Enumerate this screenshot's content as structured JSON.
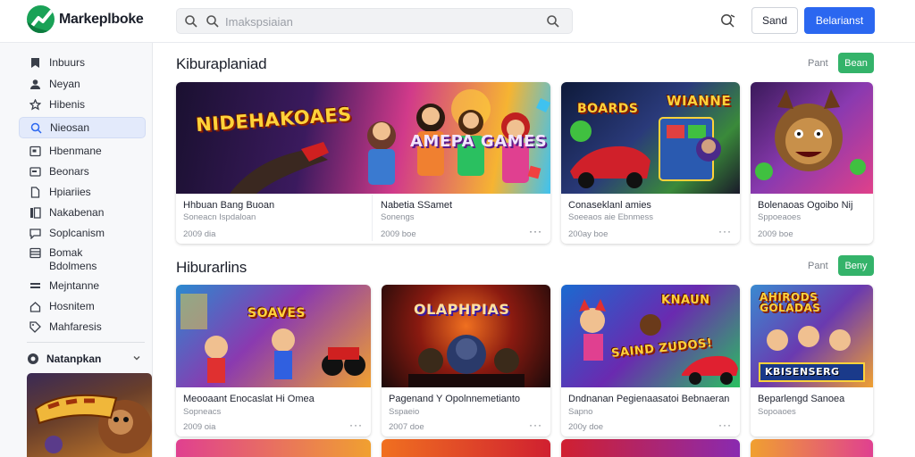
{
  "app": {
    "brand": "Markeplboke",
    "search_placeholder": "Imakspsiaian",
    "header_buttons": {
      "secondary": "Sand",
      "primary": "Belarianst"
    },
    "colors": {
      "primary": "#2b67f0",
      "brand": "#1aa257",
      "accent_green": "#34b36a"
    }
  },
  "sidebar": {
    "items": [
      {
        "label": "Inbuurs",
        "icon": "bookmark-icon"
      },
      {
        "label": "Neyan",
        "icon": "user-icon"
      },
      {
        "label": "Hibenis",
        "icon": "star-icon"
      },
      {
        "label": "Nieosan",
        "icon": "search-icon",
        "active": true
      },
      {
        "label": "Hbenmane",
        "icon": "window-icon"
      },
      {
        "label": "Beonars",
        "icon": "folder-icon"
      },
      {
        "label": "Hpiariies",
        "icon": "document-icon"
      },
      {
        "label": "Nakabenan",
        "icon": "columns-icon"
      },
      {
        "label": "Soplcanism",
        "icon": "chat-icon"
      },
      {
        "label": "Bomak",
        "label2": "Bdolmens",
        "icon": "inbox-icon"
      },
      {
        "label": "Mejntanne",
        "icon": "list-icon"
      },
      {
        "label": "Hosnitem",
        "icon": "home-icon"
      },
      {
        "label": "Mahfaresis",
        "icon": "tag-icon"
      }
    ],
    "section": {
      "title": "Natanpkan",
      "icon": "globe-icon"
    }
  },
  "sections": [
    {
      "title": "Kiburaplaniad",
      "link": "Pant",
      "button": "Bean",
      "cards": [
        {
          "title": "Hhbuan Bang Buoan",
          "subtitle": "Soneacn Ispdaloan",
          "meta": "2009 dia",
          "art_text": "NIDEHAKOAES"
        },
        {
          "title": "Nabetia SSamet",
          "subtitle": "Sonengs",
          "meta": "2009 boe",
          "art_text": "AMEPA GAMES"
        },
        {
          "title": "Conaseklanl amies",
          "subtitle": "Soeeaos aie Ebnmess",
          "meta": "200ay boe",
          "art_text": "WIANNE"
        },
        {
          "title": "Bolenaoas Ogoibo Nij",
          "subtitle": "Sppoeaoes",
          "meta": "2009 boe",
          "art_text": ""
        }
      ]
    },
    {
      "title": "Hiburarlins",
      "link": "Pant",
      "button": "Beny",
      "cards": [
        {
          "title": "Meooaant Enocaslat Hi Omea",
          "subtitle": "Sopneacs",
          "meta": "2009 oia",
          "art_text": "SOAVES"
        },
        {
          "title": "Pagenand Y Opolnnemetianto",
          "subtitle": "Sspaeio",
          "meta": "2007 doe",
          "art_text": "OLAPHPIAS"
        },
        {
          "title": "Dndnanan Pegienaasatoi Bebnaeran",
          "subtitle": "Sapno",
          "meta": "200y doe",
          "art_text": "KNAUN"
        },
        {
          "title": "Beparlengd Sanoea",
          "subtitle": "Sopoaoes",
          "meta": "",
          "art_text": "AHIRODS GOLADAS"
        }
      ]
    }
  ]
}
